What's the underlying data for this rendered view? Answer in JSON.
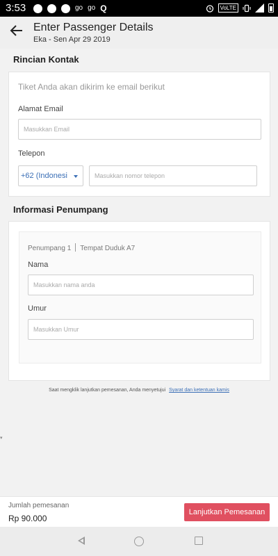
{
  "status_bar": {
    "time": "3:53",
    "icons": [
      "chat-bubble-icon",
      "message-icon",
      "go-icon",
      "go-icon",
      "q-icon",
      "alarm-icon",
      "volte-icon",
      "vibrate-icon",
      "signal-icon",
      "battery-icon"
    ],
    "go_label_1": "go",
    "go_label_2": "go",
    "q_label": "Q",
    "volte_label": "VoLTE"
  },
  "header": {
    "title": "Enter Passenger Details",
    "subtitle": "Eka - Sen Apr 29 2019"
  },
  "contact": {
    "section_title": "Rincian Kontak",
    "hint": "Tiket Anda akan dikirim ke email berikut",
    "email_label": "Alamat Email",
    "email_placeholder": "Masukkan Email",
    "email_value": "",
    "phone_label": "Telepon",
    "country_code": "+62 (Indonesi",
    "phone_placeholder": "Masukkan nomor telepon",
    "phone_value": ""
  },
  "passenger": {
    "section_title": "Informasi Penumpang",
    "passenger_label": "Penumpang 1",
    "seat_label": "Tempat Duduk A7",
    "name_label": "Nama",
    "name_placeholder": "Masukkan nama anda",
    "name_value": "",
    "age_label": "Umur",
    "age_placeholder": "Masukkan Umur",
    "age_value": ""
  },
  "terms": {
    "text": "Saat mengklik lanjutkan pemesanan, Anda menyetujui",
    "link": "Syarat dan ketentuan kamis"
  },
  "footer": {
    "total_label": "Jumlah pemesanan",
    "total_value": "Rp 90.000",
    "button_label": "Lanjutkan Pemesanan"
  },
  "colors": {
    "accent": "#e05060",
    "link": "#3b6fb6"
  }
}
